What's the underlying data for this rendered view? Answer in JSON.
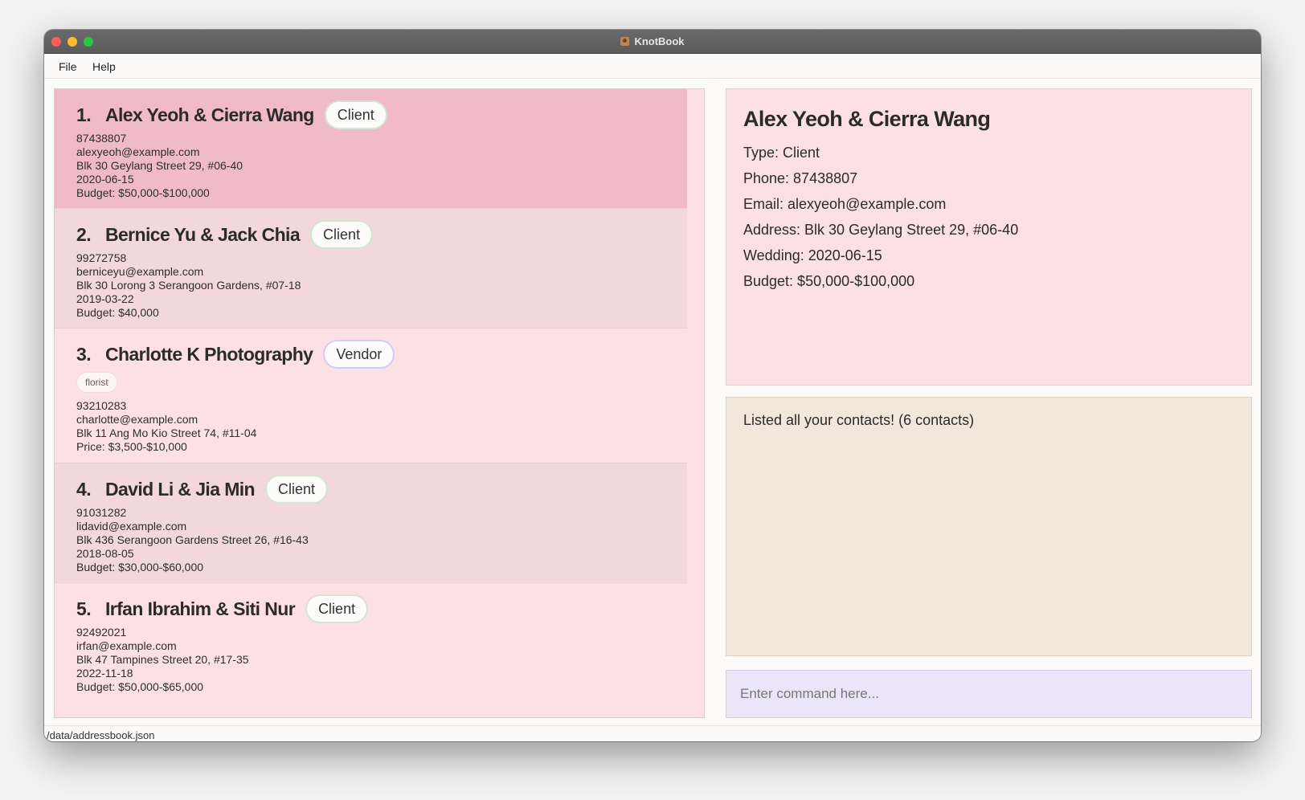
{
  "window": {
    "title": "KnotBook"
  },
  "menu": {
    "file": "File",
    "help": "Help"
  },
  "contacts": [
    {
      "num": "1.",
      "name": "Alex Yeoh & Cierra Wang",
      "type": "Client",
      "phone": "87438807",
      "email": "alexyeoh@example.com",
      "address": "Blk 30 Geylang Street 29, #06-40",
      "date": "2020-06-15",
      "budget": "Budget: $50,000-$100,000",
      "bg": "#f0bac6"
    },
    {
      "num": "2.",
      "name": "Bernice Yu & Jack Chia",
      "type": "Client",
      "phone": "99272758",
      "email": "berniceyu@example.com",
      "address": "Blk 30 Lorong 3 Serangoon Gardens, #07-18",
      "date": "2019-03-22",
      "budget": "Budget: $40,000",
      "bg": "#f2d7dc"
    },
    {
      "num": "3.",
      "name": "Charlotte K Photography",
      "type": "Vendor",
      "tag": "florist",
      "phone": "93210283",
      "email": "charlotte@example.com",
      "address": "Blk 11 Ang Mo Kio Street 74, #11-04",
      "price": "Price: $3,500-$10,000",
      "bg": "#fde0e6"
    },
    {
      "num": "4.",
      "name": "David Li & Jia Min",
      "type": "Client",
      "phone": "91031282",
      "email": "lidavid@example.com",
      "address": "Blk 436 Serangoon Gardens Street 26, #16-43",
      "date": "2018-08-05",
      "budget": "Budget: $30,000-$60,000",
      "bg": "#f2d7dc"
    },
    {
      "num": "5.",
      "name": "Irfan Ibrahim & Siti Nur",
      "type": "Client",
      "phone": "92492021",
      "email": "irfan@example.com",
      "address": "Blk 47 Tampines Street 20, #17-35",
      "date": "2022-11-18",
      "budget": "Budget: $50,000-$65,000",
      "bg": "#fde0e6"
    }
  ],
  "detail": {
    "name": "Alex Yeoh & Cierra Wang",
    "type": "Type: Client",
    "phone": "Phone: 87438807",
    "email": "Email: alexyeoh@example.com",
    "address": "Address: Blk 30 Geylang Street 29, #06-40",
    "wedding": "Wedding: 2020-06-15",
    "budget": "Budget: $50,000-$100,000"
  },
  "result": {
    "text": "Listed all your contacts! (6 contacts)"
  },
  "command": {
    "placeholder": "Enter command here..."
  },
  "status": {
    "path": "/data/addressbook.json"
  },
  "colors": {
    "selected_card": "#f0bac6",
    "detail_bg": "#fde0e6",
    "result_bg": "#f3e6da",
    "command_bg": "#eae5f9"
  }
}
